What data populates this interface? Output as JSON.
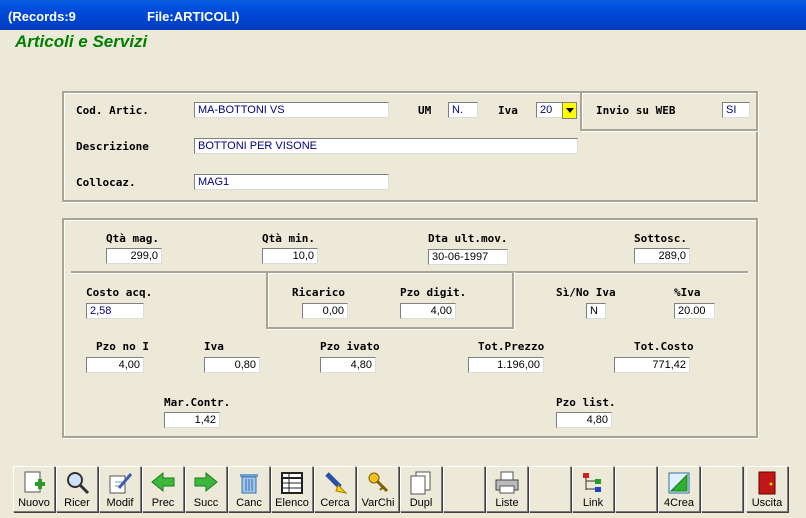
{
  "window": {
    "records": "(Records:9",
    "file": "File:ARTICOLI)"
  },
  "page": {
    "title": "Articoli e Servizi"
  },
  "article": {
    "cod_label": "Cod. Artic.",
    "cod_value": "MA-BOTTONI VS",
    "um_label": "UM",
    "um_value": "N.",
    "iva_label": "Iva",
    "iva_value": "20",
    "web_label": "Invio su WEB",
    "web_value": "SI",
    "desc_label": "Descrizione",
    "desc_value": "BOTTONI PER VISONE",
    "coll_label": "Collocaz.",
    "coll_value": "MAG1"
  },
  "stock": {
    "qta_mag_label": "Qtà mag.",
    "qta_mag_value": "299,0",
    "qta_min_label": "Qtà min.",
    "qta_min_value": "10,0",
    "dta_label": "Dta ult.mov.",
    "dta_value": "30-06-1997",
    "sottosc_label": "Sottosc.",
    "sottosc_value": "289,0"
  },
  "pricing": {
    "costo_label": "Costo acq.",
    "costo_value": "2,58",
    "ricarico_label": "Ricarico",
    "ricarico_value": "0,00",
    "pzo_digit_label": "Pzo digit.",
    "pzo_digit_value": "4,00",
    "sino_label": "Sì/No Iva",
    "sino_value": "N",
    "piva_label": "%Iva",
    "piva_value": "20.00",
    "pzo_no_label": "Pzo no I",
    "pzo_no_value": "4,00",
    "iva_label": "Iva",
    "iva_value": "0,80",
    "pzo_ivato_label": "Pzo ivato",
    "pzo_ivato_value": "4,80",
    "tot_prezzo_label": "Tot.Prezzo",
    "tot_prezzo_value": "1.196,00",
    "tot_costo_label": "Tot.Costo",
    "tot_costo_value": "771,42",
    "mar_label": "Mar.Contr.",
    "mar_value": "1,42",
    "pzo_list_label": "Pzo list.",
    "pzo_list_value": "4,80"
  },
  "toolbar": {
    "nuovo": "Nuovo",
    "ricer": "Ricer",
    "modif": "Modif",
    "prec": "Prec",
    "succ": "Succ",
    "canc": "Canc",
    "elenco": "Elenco",
    "cerca": "Cerca",
    "varchi": "VarChi",
    "dupl": "Dupl",
    "liste": "Liste",
    "link": "Link",
    "crea": "4Crea",
    "uscita": "Uscita"
  }
}
